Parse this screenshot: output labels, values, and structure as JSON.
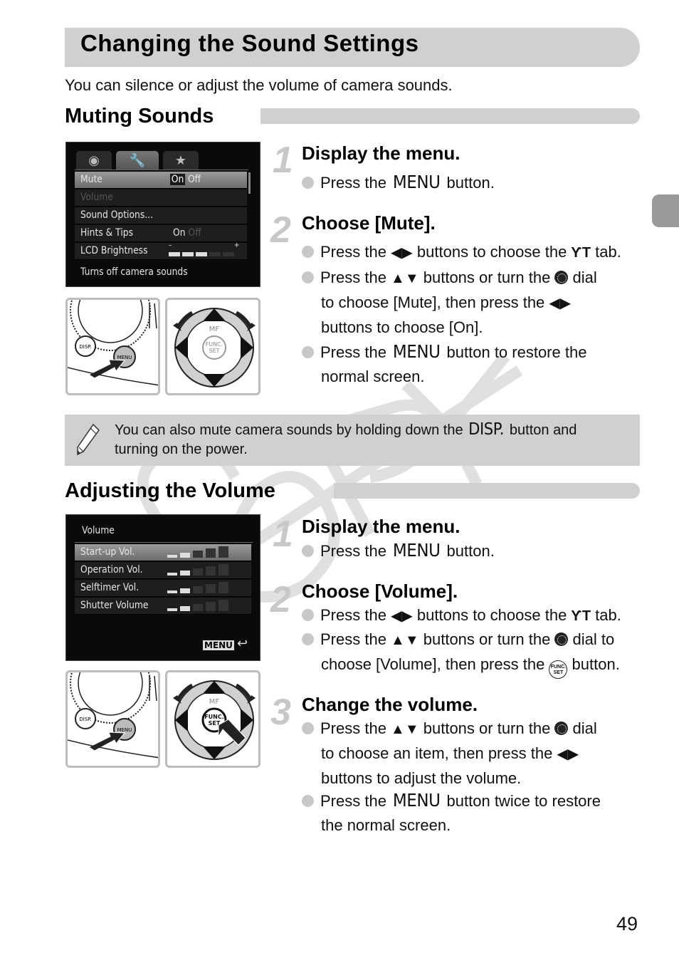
{
  "page": {
    "title": "Changing the Sound Settings",
    "intro": "You can silence or adjust the volume of camera sounds.",
    "page_number": "49",
    "watermark": "COPY"
  },
  "muting": {
    "heading": "Muting Sounds",
    "screen": {
      "tabs": [
        {
          "icon": "camera-icon",
          "glyph": "◘"
        },
        {
          "icon": "tools-icon",
          "glyph": "ƳT"
        },
        {
          "icon": "star-icon",
          "glyph": "★"
        }
      ],
      "rows": [
        {
          "label": "Mute",
          "value_on": "On",
          "value_off": "Off",
          "selected": true
        },
        {
          "label": "Volume",
          "disabled": true
        },
        {
          "label": "Sound Options..."
        },
        {
          "label": "Hints & Tips",
          "value_on": "On",
          "value_off": "Off"
        },
        {
          "label": "LCD Brightness",
          "minus": "–",
          "plus": "+",
          "level": 3,
          "max": 5
        }
      ],
      "hint": "Turns off camera sounds"
    },
    "diagram_left": {
      "disp_label": "DISP.",
      "menu_label": "MENU"
    },
    "diagram_right": {
      "top_label": "MF",
      "center_label_1": "FUNC.",
      "center_label_2": "SET"
    },
    "steps": [
      {
        "number": "1",
        "title": "Display the menu.",
        "bullets": [
          {
            "pre": "Press the ",
            "key": "MENU",
            "post": " button."
          }
        ]
      },
      {
        "number": "2",
        "title": "Choose [Mute].",
        "bullets": [
          {
            "pre": "Press the ",
            "glyph": "◀▶",
            "mid": " buttons to choose the ",
            "glyph2": "ƳT",
            "post": " tab."
          },
          {
            "line1_pre": "Press the ",
            "glyph": "▲▼",
            "line1_mid": " buttons or turn the ",
            "line1_post": " dial",
            "line2_pre": "to choose [Mute], then press the ",
            "glyph2": "◀▶",
            "line3": "buttons to choose [On]."
          },
          {
            "pre": "Press the ",
            "key": "MENU",
            "post": " button to restore the",
            "line2": "normal screen."
          }
        ]
      }
    ]
  },
  "note": {
    "icon": "pencil-icon",
    "line1_pre": "You can also mute camera sounds by holding down the ",
    "key": "DISP.",
    "line1_post": " button and",
    "line2": "turning on the power."
  },
  "volume": {
    "heading": "Adjusting the Volume",
    "screen": {
      "title": "Volume",
      "rows": [
        {
          "label": "Start-up Vol.",
          "level": 2,
          "max": 5,
          "selected": true
        },
        {
          "label": "Operation Vol.",
          "level": 2,
          "max": 5
        },
        {
          "label": "Selftimer Vol.",
          "level": 2,
          "max": 5
        },
        {
          "label": "Shutter Volume",
          "level": 2,
          "max": 5
        }
      ],
      "footer_key": "MENU",
      "footer_icon": "↩"
    },
    "diagram_left": {
      "disp_label": "DISP.",
      "menu_label": "MENU"
    },
    "diagram_right": {
      "top_label": "MF",
      "center_label_1": "FUNC.",
      "center_label_2": "SET"
    },
    "steps": [
      {
        "number": "1",
        "title": "Display the menu.",
        "bullets": [
          {
            "pre": "Press the ",
            "key": "MENU",
            "post": " button."
          }
        ]
      },
      {
        "number": "2",
        "title": "Choose [Volume].",
        "bullets": [
          {
            "pre": "Press the ",
            "glyph": "◀▶",
            "mid": " buttons to choose the ",
            "glyph2": "ƳT",
            "post": " tab."
          },
          {
            "line1_pre": "Press the ",
            "glyph": "▲▼",
            "line1_mid": " buttons or turn the ",
            "line1_post": " dial to",
            "line2_pre": "choose [Volume], then press the ",
            "func1": "FUNC.",
            "func2": "SET",
            "line2_post": " button."
          }
        ]
      },
      {
        "number": "3",
        "title": "Change the volume.",
        "bullets": [
          {
            "line1_pre": "Press the ",
            "glyph": "▲▼",
            "line1_mid": " buttons or turn the ",
            "line1_post": " dial",
            "line2_pre": "to choose an item, then press the ",
            "glyph2": "◀▶",
            "line3": "buttons to adjust the volume."
          },
          {
            "pre": "Press the ",
            "key": "MENU",
            "post": " button twice to restore",
            "line2": "the normal screen."
          }
        ]
      }
    ]
  }
}
